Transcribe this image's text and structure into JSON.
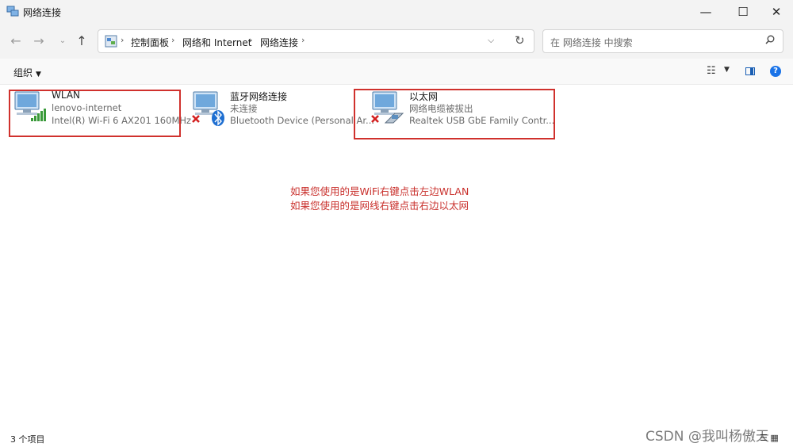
{
  "window": {
    "title": "网络连接"
  },
  "nav": {
    "breadcrumbs": [
      "控制面板",
      "网络和 Internet",
      "网络连接"
    ],
    "search_placeholder": "在 网络连接 中搜索"
  },
  "toolbar": {
    "organize_label": "组织"
  },
  "connections": [
    {
      "name": "WLAN",
      "status": "lenovo-internet",
      "device": "Intel(R) Wi-Fi 6 AX201 160MHz",
      "icon": "wifi-adapter-icon"
    },
    {
      "name": "蓝牙网络连接",
      "status": "未连接",
      "device": "Bluetooth Device (Personal Ar...",
      "icon": "bluetooth-adapter-icon"
    },
    {
      "name": "以太网",
      "status": "网络电缆被拔出",
      "device": "Realtek USB GbE Family Contr...",
      "icon": "ethernet-adapter-icon"
    }
  ],
  "annotation": {
    "line1": "如果您使用的是WiFi右键点击左边WLAN",
    "line2": "如果您使用的是网线右键点击右边以太网",
    "color": "#c9302c"
  },
  "status": {
    "item_count": "3 个项目"
  },
  "watermark": "CSDN @我叫杨傲天",
  "colors": {
    "highlight": "#d0312d",
    "accent": "#1a73e8"
  }
}
